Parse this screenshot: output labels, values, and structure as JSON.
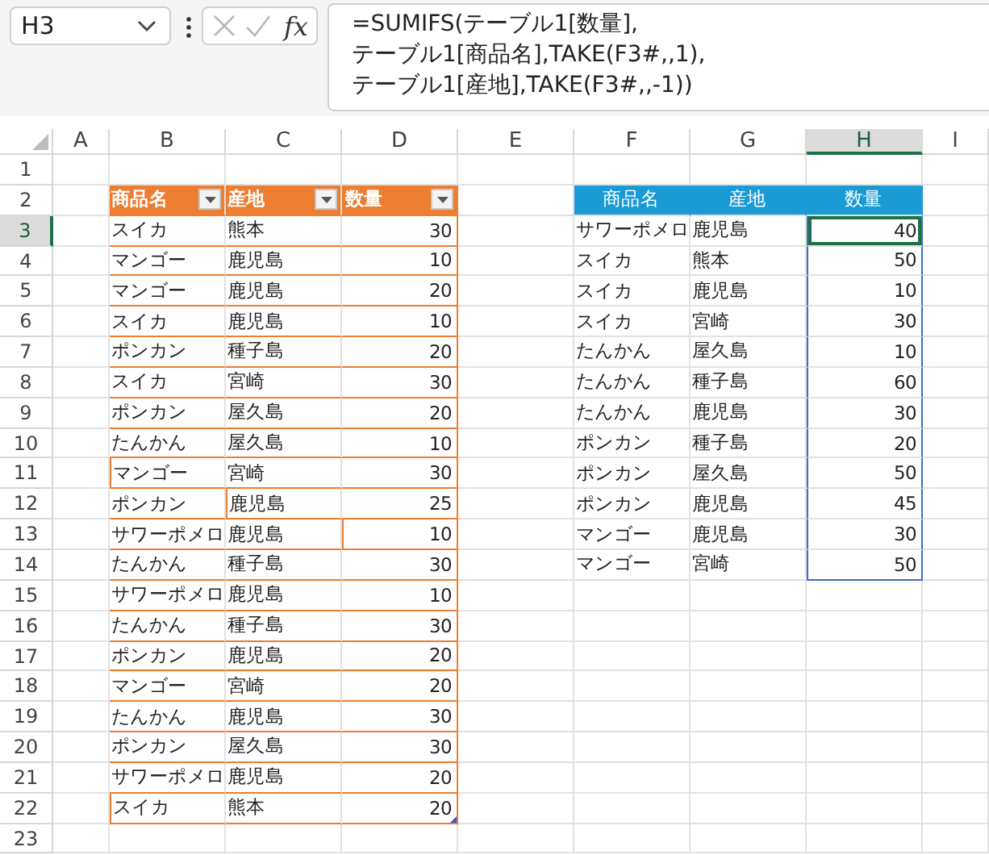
{
  "name_box": {
    "value": "H3"
  },
  "formula_bar": {
    "function_label": "fx",
    "cancel_disabled": true,
    "enter_disabled": true,
    "lines": [
      "=SUMIFS(テーブル1[数量],",
      "テーブル1[商品名],TAKE(F3#,,1),",
      "テーブル1[産地],TAKE(F3#,,-1))"
    ]
  },
  "columns": [
    {
      "label": "A",
      "selected": false
    },
    {
      "label": "B",
      "selected": false
    },
    {
      "label": "C",
      "selected": false
    },
    {
      "label": "D",
      "selected": false
    },
    {
      "label": "E",
      "selected": false
    },
    {
      "label": "F",
      "selected": false
    },
    {
      "label": "G",
      "selected": false
    },
    {
      "label": "H",
      "selected": true
    },
    {
      "label": "I",
      "selected": false
    }
  ],
  "rows": [
    {
      "label": "1",
      "selected": false
    },
    {
      "label": "2",
      "selected": false
    },
    {
      "label": "3",
      "selected": true
    },
    {
      "label": "4",
      "selected": false
    },
    {
      "label": "5",
      "selected": false
    },
    {
      "label": "6",
      "selected": false
    },
    {
      "label": "7",
      "selected": false
    },
    {
      "label": "8",
      "selected": false
    },
    {
      "label": "9",
      "selected": false
    },
    {
      "label": "10",
      "selected": false
    },
    {
      "label": "11",
      "selected": false
    },
    {
      "label": "12",
      "selected": false
    },
    {
      "label": "13",
      "selected": false
    },
    {
      "label": "14",
      "selected": false
    },
    {
      "label": "15",
      "selected": false
    },
    {
      "label": "16",
      "selected": false
    },
    {
      "label": "17",
      "selected": false
    },
    {
      "label": "18",
      "selected": false
    },
    {
      "label": "19",
      "selected": false
    },
    {
      "label": "20",
      "selected": false
    },
    {
      "label": "21",
      "selected": false
    },
    {
      "label": "22",
      "selected": false
    },
    {
      "label": "23",
      "selected": false
    }
  ],
  "table1": {
    "columns": [
      "商品名",
      "産地",
      "数量"
    ],
    "rows": [
      [
        "スイカ",
        "熊本",
        "30"
      ],
      [
        "マンゴー",
        "鹿児島",
        "10"
      ],
      [
        "マンゴー",
        "鹿児島",
        "20"
      ],
      [
        "スイカ",
        "鹿児島",
        "10"
      ],
      [
        "ポンカン",
        "種子島",
        "20"
      ],
      [
        "スイカ",
        "宮崎",
        "30"
      ],
      [
        "ポンカン",
        "屋久島",
        "20"
      ],
      [
        "たんかん",
        "屋久島",
        "10"
      ],
      [
        "マンゴー",
        "宮崎",
        "30"
      ],
      [
        "ポンカン",
        "鹿児島",
        "25"
      ],
      [
        "サワーポメロ",
        "鹿児島",
        "10"
      ],
      [
        "たんかん",
        "種子島",
        "30"
      ],
      [
        "サワーポメロ",
        "鹿児島",
        "10"
      ],
      [
        "たんかん",
        "種子島",
        "30"
      ],
      [
        "ポンカン",
        "鹿児島",
        "20"
      ],
      [
        "マンゴー",
        "宮崎",
        "20"
      ],
      [
        "たんかん",
        "鹿児島",
        "30"
      ],
      [
        "ポンカン",
        "屋久島",
        "30"
      ],
      [
        "サワーポメロ",
        "鹿児島",
        "20"
      ],
      [
        "スイカ",
        "熊本",
        "20"
      ]
    ]
  },
  "summary": {
    "columns": [
      "商品名",
      "産地",
      "数量"
    ],
    "rows": [
      {
        "cells": [
          "サワーポメロ",
          "鹿児島",
          "40"
        ],
        "selected": true
      },
      {
        "cells": [
          "スイカ",
          "熊本",
          "50"
        ],
        "selected": false
      },
      {
        "cells": [
          "スイカ",
          "鹿児島",
          "10"
        ],
        "selected": false
      },
      {
        "cells": [
          "スイカ",
          "宮崎",
          "30"
        ],
        "selected": false
      },
      {
        "cells": [
          "たんかん",
          "屋久島",
          "10"
        ],
        "selected": false
      },
      {
        "cells": [
          "たんかん",
          "種子島",
          "60"
        ],
        "selected": false
      },
      {
        "cells": [
          "たんかん",
          "鹿児島",
          "30"
        ],
        "selected": false
      },
      {
        "cells": [
          "ポンカン",
          "種子島",
          "20"
        ],
        "selected": false
      },
      {
        "cells": [
          "ポンカン",
          "屋久島",
          "50"
        ],
        "selected": false
      },
      {
        "cells": [
          "ポンカン",
          "鹿児島",
          "45"
        ],
        "selected": false
      },
      {
        "cells": [
          "マンゴー",
          "鹿児島",
          "30"
        ],
        "selected": false
      },
      {
        "cells": [
          "マンゴー",
          "宮崎",
          "50"
        ],
        "selected": false
      }
    ]
  }
}
